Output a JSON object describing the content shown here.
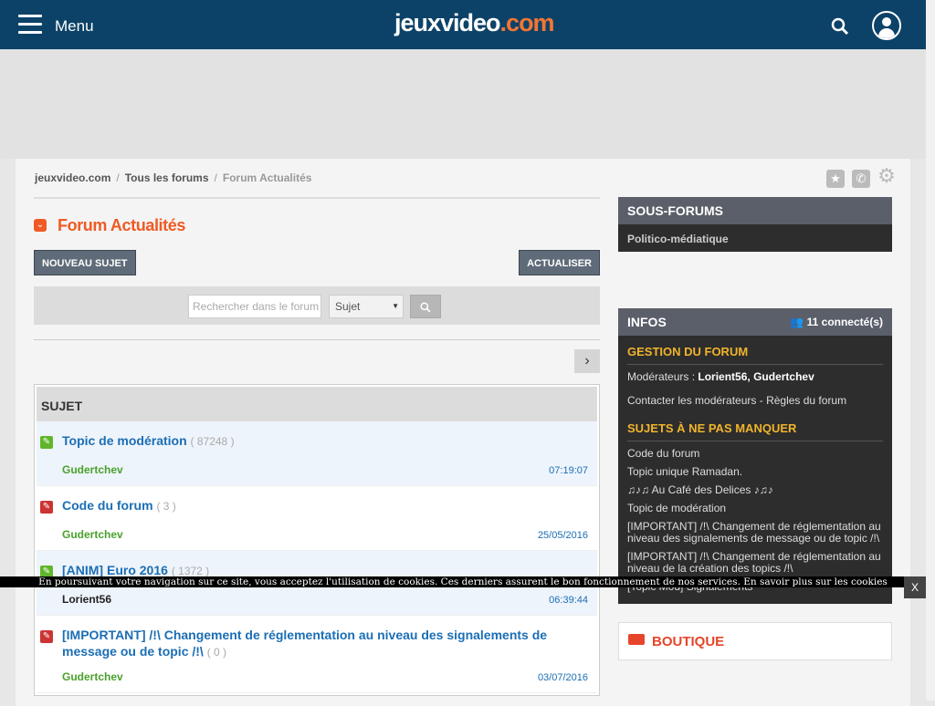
{
  "header": {
    "menu_label": "Menu",
    "logo_main": "jeuxvideo",
    "logo_tld": ".com"
  },
  "breadcrumb": {
    "home": "jeuxvideo.com",
    "sep": "/",
    "forums": "Tous les forums",
    "current": "Forum Actualités"
  },
  "forum": {
    "title": "Forum Actualités",
    "new_topic": "NOUVEAU SUJET",
    "refresh": "ACTUALISER",
    "search_placeholder": "Rechercher dans le forum",
    "search_select": "Sujet",
    "column_header": "SUJET"
  },
  "topics": [
    {
      "title": "Topic de modération",
      "count": "( 87248 )",
      "author": "Gudertchev",
      "date": "07:19:07"
    },
    {
      "title": "Code du forum",
      "count": "( 3 )",
      "author": "Gudertchev",
      "date": "25/05/2016"
    },
    {
      "title": "[ANIM] Euro 2016",
      "count": "( 1372 )",
      "author": "Lorient56",
      "date": "06:39:44"
    },
    {
      "title": "[IMPORTANT] /!\\ Changement de réglementation au niveau des signalements de message ou de topic /!\\",
      "count": "( 0 )",
      "author": "Gudertchev",
      "date": "03/07/2016"
    }
  ],
  "sidebar": {
    "subforums_title": "SOUS-FORUMS",
    "subforums": [
      "Politico-médiatique"
    ],
    "infos_title": "INFOS",
    "connected": "11 connecté(s)",
    "gestion_title": "GESTION DU FORUM",
    "moderators_label": "Modérateurs :",
    "moderators": "Lorient56, Gudertchev",
    "contact_line": "Contacter les modérateurs - Règles du forum",
    "must_see_title": "SUJETS À NE PAS MANQUER",
    "must_see": [
      "Code du forum",
      "Topic unique Ramadan.",
      "♫♪♫ Au Café des Delices ♪♫♪",
      "Topic de modération",
      "[IMPORTANT] /!\\ Changement de réglementation au niveau des signalements de message ou de topic /!\\",
      "[IMPORTANT] /!\\ Changement de réglementation au niveau de la création des topics /!\\",
      "[Topic Mod] Signalements"
    ],
    "shop_title": "BOUTIQUE"
  },
  "cookie": {
    "text": "En poursuivant votre navigation sur ce site, vous acceptez l'utilisation de cookies. Ces derniers assurent le bon fonctionnement de nos services. En savoir plus sur les cookies",
    "close": "X"
  },
  "colors": {
    "header_bg": "#0c4268",
    "brand_orange": "#f05a24",
    "link_blue": "#1b6eb5",
    "author_green": "#4aa12c",
    "sidebar_dark": "#2d2d2d",
    "sidebar_accent": "#f0b42c"
  },
  "icons": {
    "menu": "hamburger-icon",
    "search": "search-icon",
    "user": "user-icon",
    "favorite": "star-icon",
    "alert": "phone-icon",
    "settings": "gear-icon",
    "pin": "pin-icon",
    "next_page": "chevron-right-icon",
    "shop": "cart-icon"
  }
}
